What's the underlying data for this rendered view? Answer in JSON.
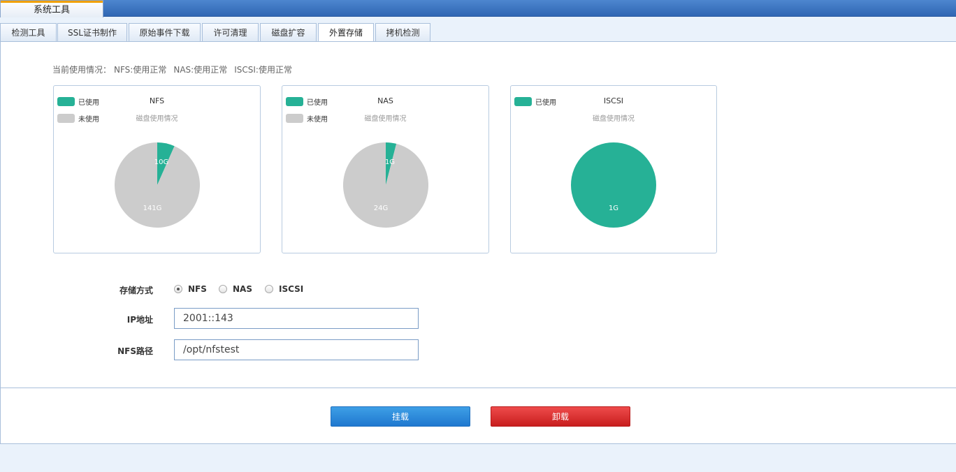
{
  "window": {
    "title": "系统工具"
  },
  "tabs": [
    {
      "label": "检测工具"
    },
    {
      "label": "SSL证书制作"
    },
    {
      "label": "原始事件下载"
    },
    {
      "label": "许可清理"
    },
    {
      "label": "磁盘扩容"
    },
    {
      "label": "外置存储",
      "active": true
    },
    {
      "label": "拷机检测"
    }
  ],
  "status": {
    "prefix": "当前使用情况：",
    "nfs": "NFS:使用正常",
    "nas": "NAS:使用正常",
    "iscsi": "ISCSI:使用正常"
  },
  "colors": {
    "used": "#26b196",
    "unused": "#cccccc",
    "mount_button": "#2a8bdc",
    "unmount_button": "#dc3030"
  },
  "chart_data": [
    {
      "type": "pie",
      "title": "NFS",
      "subtitle": "磁盘使用情况",
      "legend": [
        "已使用",
        "未使用"
      ],
      "slices": [
        {
          "name": "已使用",
          "value": 10,
          "label": "10G"
        },
        {
          "name": "未使用",
          "value": 141,
          "label": "141G"
        }
      ]
    },
    {
      "type": "pie",
      "title": "NAS",
      "subtitle": "磁盘使用情况",
      "legend": [
        "已使用",
        "未使用"
      ],
      "slices": [
        {
          "name": "已使用",
          "value": 1,
          "label": "1G"
        },
        {
          "name": "未使用",
          "value": 24,
          "label": "24G"
        }
      ]
    },
    {
      "type": "pie",
      "title": "ISCSI",
      "subtitle": "磁盘使用情况",
      "legend": [
        "已使用"
      ],
      "slices": [
        {
          "name": "已使用",
          "value": 1,
          "label": "1G"
        }
      ]
    }
  ],
  "form": {
    "storage_label": "存储方式",
    "options": [
      {
        "label": "NFS",
        "checked": true
      },
      {
        "label": "NAS",
        "checked": false
      },
      {
        "label": "ISCSI",
        "checked": false
      }
    ],
    "ip_label": "IP地址",
    "ip_value": "2001::143",
    "path_label": "NFS路径",
    "path_value": "/opt/nfstest"
  },
  "buttons": {
    "mount": "挂载",
    "unmount": "卸载"
  }
}
